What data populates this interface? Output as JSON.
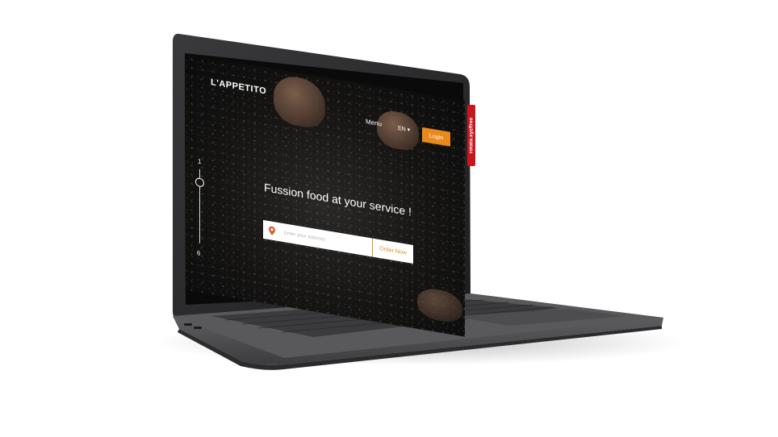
{
  "site": {
    "logo": "L'APPETITO",
    "nav": {
      "menu_label": "Menu",
      "language_label": "EN ▾",
      "login_label": "Login"
    },
    "pager": {
      "current": "1",
      "total": "6"
    },
    "hero": {
      "title": "Fussion food at your service !",
      "address_placeholder": "Enter your address",
      "order_label": "Order Now"
    }
  },
  "brand_tag": "rotato.xyz/free",
  "icons": {
    "location": "map-pin-icon"
  },
  "colors": {
    "accent": "#e8891c",
    "tag": "#c8161d",
    "screen_bg": "#141312"
  }
}
